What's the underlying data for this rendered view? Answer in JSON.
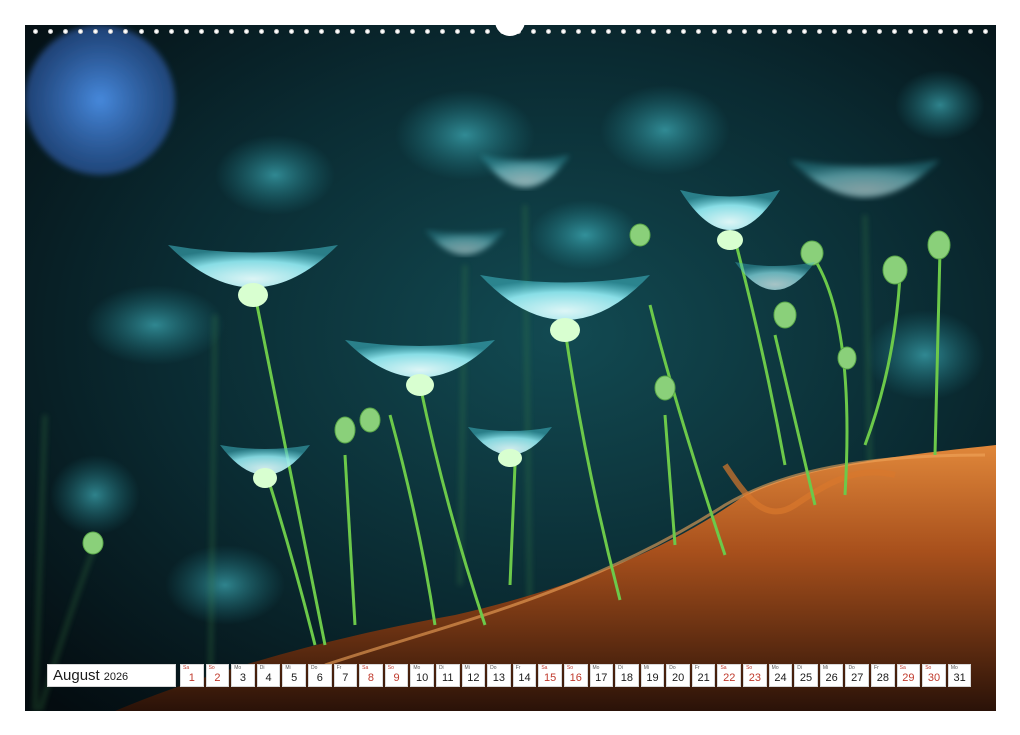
{
  "calendar": {
    "month": "August",
    "year": "2026",
    "days": [
      {
        "wd": "Sa",
        "num": "1",
        "weekend": true
      },
      {
        "wd": "So",
        "num": "2",
        "weekend": true
      },
      {
        "wd": "Mo",
        "num": "3",
        "weekend": false
      },
      {
        "wd": "Di",
        "num": "4",
        "weekend": false
      },
      {
        "wd": "Mi",
        "num": "5",
        "weekend": false
      },
      {
        "wd": "Do",
        "num": "6",
        "weekend": false
      },
      {
        "wd": "Fr",
        "num": "7",
        "weekend": false
      },
      {
        "wd": "Sa",
        "num": "8",
        "weekend": true
      },
      {
        "wd": "So",
        "num": "9",
        "weekend": true
      },
      {
        "wd": "Mo",
        "num": "10",
        "weekend": false
      },
      {
        "wd": "Di",
        "num": "11",
        "weekend": false
      },
      {
        "wd": "Mi",
        "num": "12",
        "weekend": false
      },
      {
        "wd": "Do",
        "num": "13",
        "weekend": false
      },
      {
        "wd": "Fr",
        "num": "14",
        "weekend": false
      },
      {
        "wd": "Sa",
        "num": "15",
        "weekend": true
      },
      {
        "wd": "So",
        "num": "16",
        "weekend": true
      },
      {
        "wd": "Mo",
        "num": "17",
        "weekend": false
      },
      {
        "wd": "Di",
        "num": "18",
        "weekend": false
      },
      {
        "wd": "Mi",
        "num": "19",
        "weekend": false
      },
      {
        "wd": "Do",
        "num": "20",
        "weekend": false
      },
      {
        "wd": "Fr",
        "num": "21",
        "weekend": false
      },
      {
        "wd": "Sa",
        "num": "22",
        "weekend": true
      },
      {
        "wd": "So",
        "num": "23",
        "weekend": true
      },
      {
        "wd": "Mo",
        "num": "24",
        "weekend": false
      },
      {
        "wd": "Di",
        "num": "25",
        "weekend": false
      },
      {
        "wd": "Mi",
        "num": "26",
        "weekend": false
      },
      {
        "wd": "Do",
        "num": "27",
        "weekend": false
      },
      {
        "wd": "Fr",
        "num": "28",
        "weekend": false
      },
      {
        "wd": "Sa",
        "num": "29",
        "weekend": true
      },
      {
        "wd": "So",
        "num": "30",
        "weekend": true
      },
      {
        "wd": "Mo",
        "num": "31",
        "weekend": false
      }
    ]
  },
  "photo": {
    "icon": "macro-flowers-photo",
    "colors": {
      "background": "#071418",
      "glow": "#37b8c4",
      "bokeh_blue": "#3b7fd6",
      "flower": "#9ff0f5",
      "stem": "#5fbf3a",
      "wood": "#b5561a"
    }
  },
  "colors": {
    "weekend_text": "#c0392b",
    "text": "#1a1a1a"
  }
}
